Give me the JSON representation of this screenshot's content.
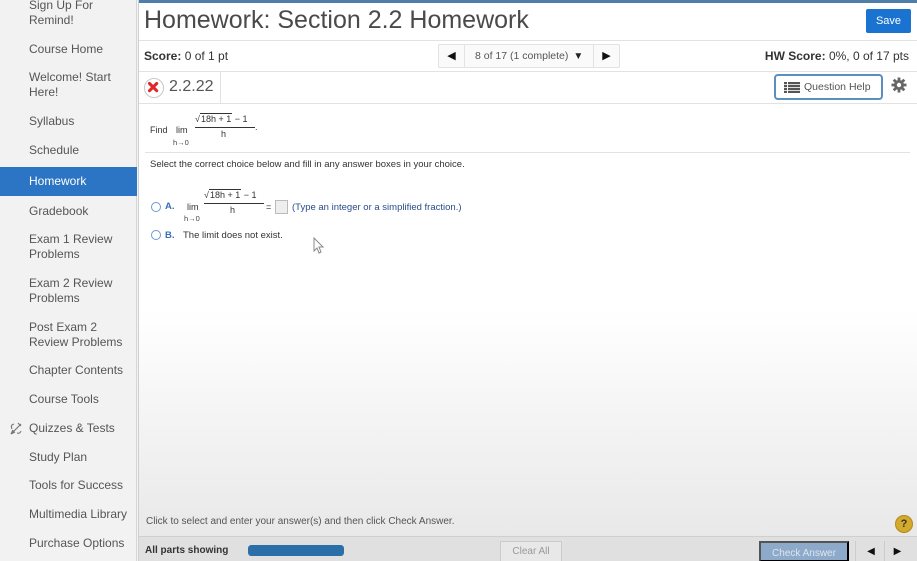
{
  "sidebar": {
    "items": [
      {
        "label": "Sign Up For Remind!",
        "active": false
      },
      {
        "label": "Course Home",
        "active": false
      },
      {
        "label": "Welcome! Start Here!",
        "active": false
      },
      {
        "label": "Syllabus",
        "active": false
      },
      {
        "label": "Schedule",
        "active": false
      },
      {
        "label": "Homework",
        "active": true
      },
      {
        "label": "Gradebook",
        "active": false
      },
      {
        "label": "Exam 1 Review Problems",
        "active": false
      },
      {
        "label": "Exam 2 Review Problems",
        "active": false
      },
      {
        "label": "Post Exam 2 Review Problems",
        "active": false
      },
      {
        "label": "Chapter Contents",
        "active": false
      },
      {
        "label": "Course Tools",
        "active": false
      },
      {
        "label": "Quizzes & Tests",
        "active": false,
        "icon": "quiz-pencil-icon"
      },
      {
        "label": "Study Plan",
        "active": false
      },
      {
        "label": "Tools for Success",
        "active": false
      },
      {
        "label": "Multimedia Library",
        "active": false
      },
      {
        "label": "Purchase Options",
        "active": false
      }
    ],
    "active_color": "#2c74c4"
  },
  "header": {
    "title": "Homework: Section 2.2 Homework",
    "save_label": "Save"
  },
  "score": {
    "label": "Score:",
    "value": "0 of 1 pt",
    "hw_label": "HW Score:",
    "hw_value": "0%, 0 of 17 pts"
  },
  "question_nav": {
    "prev_icon": "◀",
    "next_icon": "▶",
    "label": "8 of 17 (1 complete)",
    "caret": "▼"
  },
  "question": {
    "id": "2.2.22",
    "status_icon": "incorrect-x-icon",
    "help_label": "Question Help",
    "prompt_prefix": "Find",
    "lim": "lim",
    "lim_sub": "h→0",
    "numerator_radicand": "18h + 1",
    "numerator_rest": " − 1",
    "denominator": "h",
    "period": ".",
    "instruction": "Select the correct choice below and fill in any answer boxes in your choice.",
    "choices": [
      {
        "letter": "A.",
        "equals": "=",
        "answer_value": "",
        "hint": "(Type an integer or a simplified fraction.)"
      },
      {
        "letter": "B.",
        "text": "The limit does not exist."
      }
    ]
  },
  "footer": {
    "message": "Click to select and enter your answer(s) and then click Check Answer.",
    "help_icon": "?",
    "parts_label": "All parts showing",
    "progress_fraction": 1.0,
    "clear_all_label": "Clear All",
    "check_answer_label": "Check Answer",
    "prev_icon": "◀",
    "next_icon": "▶"
  }
}
